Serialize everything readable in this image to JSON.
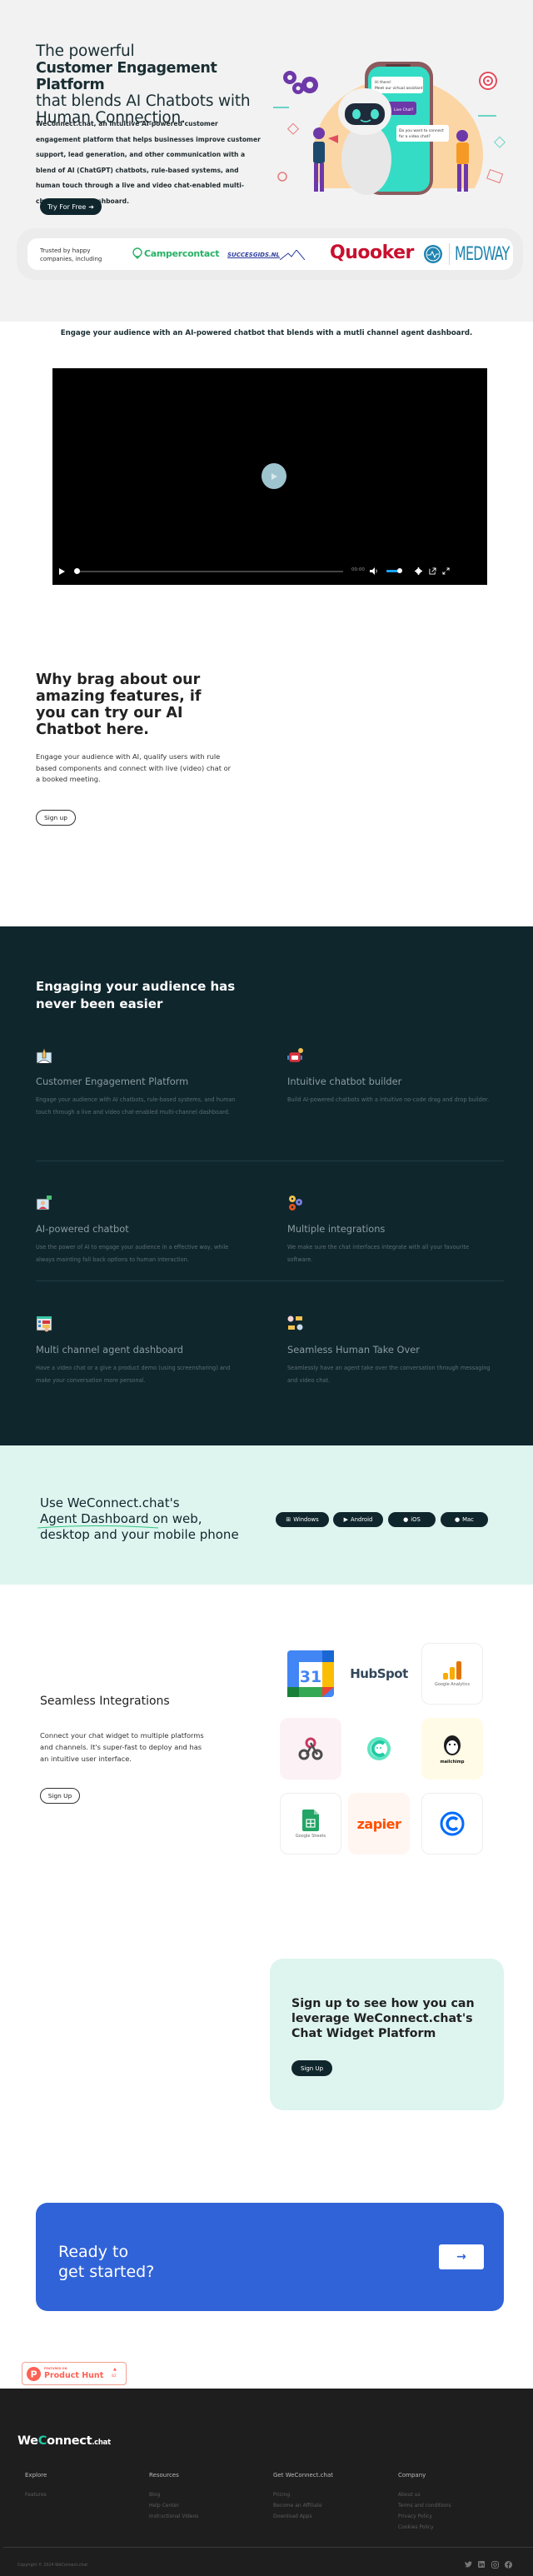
{
  "hero": {
    "title_line1": "The powerful",
    "title_bold": "Customer Engagement Platform",
    "title_line3": "that blends AI Chatbots with Human Connection.",
    "description": "WeConnect.chat, an intuitive AI-powered customer engagement platform that helps businesses improve customer support, lead generation, and other communication with a blend of AI (ChatGPT) chatbots, rule-based systems, and human touch through a live and video chat-enabled multi-channel agent dashboard.",
    "cta_label": "Try For Free",
    "cta_icon": "arrow-right-icon",
    "illustration": {
      "bubble1_line1": "Hi there!",
      "bubble1_line2": "Meet our virtual assistant",
      "bubble2": "Live Chat?",
      "bubble3_line1": "Do you want to connect",
      "bubble3_line2": "for a video chat?"
    }
  },
  "trusted": {
    "label": "Trusted by happy companies, including",
    "logos": [
      "Campercontact",
      "SUCCESGIDS.NL",
      "Quooker",
      "MEDWAY"
    ]
  },
  "video_section": {
    "subtitle": "Engage your audience with an AI-powered chatbot that blends with a mutli channel agent dashboard.",
    "player": {
      "time": "00:00",
      "progress_percent": 0,
      "volume_percent": 100,
      "icons": [
        "play-icon",
        "volume-icon",
        "settings-icon",
        "external-link-icon",
        "fullscreen-icon"
      ]
    }
  },
  "try_section": {
    "title": "Why brag about our amazing features, if you can try our AI Chatbot here.",
    "description": "Engage your audience with AI, qualify users with rule based components and connect with live (video) chat or a booked meeting.",
    "button_label": "Sign up"
  },
  "features": {
    "title": "Engaging your audience has never been easier",
    "items": [
      {
        "icon": "rocket-launch-icon",
        "title": "Customer Engagement Platform",
        "text": "Engage your audience with AI chatbots, rule-based systems, and human touch through a live and video chat-enabled multi-channel dashboard."
      },
      {
        "icon": "robot-icon",
        "title": "Intuitive chatbot builder",
        "text": "Build AI-powered chatbots with a intuitive no-code drag and drop builder."
      },
      {
        "icon": "video-agent-icon",
        "title": "AI-powered chatbot",
        "text": "Use the power of AI to engage your audience in a effective way, while always mainting fall back options to human interaction."
      },
      {
        "icon": "gears-icon",
        "title": "Multiple integrations",
        "text": "We make sure the chat interfaces integrate with all your favourite software."
      },
      {
        "icon": "dashboard-icon",
        "title": "Multi channel agent dashboard",
        "text": "Have a video chat or a give a product demo (using screensharing) and make your conversation more personal."
      },
      {
        "icon": "takeover-icon",
        "title": "Seamless Human Take Over",
        "text": "Seamlessly have an agent take over the conversation through messaging and video chat."
      }
    ]
  },
  "apps": {
    "title_line1": "Use WeConnect.chat's",
    "title_highlight": "Agent Dashboard",
    "title_line2_rest": " on web,",
    "title_line3": "desktop and your mobile phone",
    "buttons": [
      {
        "label": "Windows",
        "icon": "windows-icon"
      },
      {
        "label": "Android",
        "icon": "play-store-icon"
      },
      {
        "label": "iOS",
        "icon": "apple-icon"
      },
      {
        "label": "Mac",
        "icon": "apple-icon"
      }
    ]
  },
  "integrations": {
    "title": "Seamless Integrations",
    "description": "Connect your chat widget to multiple platforms and channels. It's super-fast to deploy and has an intuitive user interface.",
    "button_label": "Sign Up",
    "tiles": [
      {
        "name": "Google Calendar",
        "text": "31"
      },
      {
        "name": "HubSpot",
        "text": "HubSpot"
      },
      {
        "name": "Google Analytics",
        "text": "Google Analytics"
      },
      {
        "name": "Webhooks",
        "text": ""
      },
      {
        "name": "WeConnect",
        "text": ""
      },
      {
        "name": "Mailchimp",
        "text": "mailchimp"
      },
      {
        "name": "Google Sheets",
        "text": "Google Sheets"
      },
      {
        "name": "Zapier",
        "text": "zapier"
      },
      {
        "name": "Calendly",
        "text": ""
      }
    ]
  },
  "signup_card": {
    "title": "Sign up to see how you can leverage WeConnect.chat's Chat Widget Platform",
    "button_label": "Sign Up"
  },
  "ready": {
    "title_line1": "Ready to",
    "title_line2": "get started?",
    "button_icon": "arrow-right-icon"
  },
  "product_hunt": {
    "small": "FEATURED ON",
    "label": "Product Hunt",
    "votes": "82"
  },
  "footer": {
    "logo_we": "We",
    "logo_c": "C",
    "logo_onnect": "onnect",
    "logo_chat": ".chat",
    "columns": [
      {
        "title": "Explore",
        "links": [
          "Features"
        ]
      },
      {
        "title": "Resources",
        "links": [
          "Blog",
          "Help Center",
          "Instructional Videos"
        ]
      },
      {
        "title": "Get WeConnect.chat",
        "links": [
          "Pricing",
          "Become an Affiliate",
          "Download Apps"
        ]
      },
      {
        "title": "Company",
        "links": [
          "About us",
          "Terms and conditions",
          "Privacy Policy",
          "Cookies Policy"
        ]
      }
    ],
    "copyright": "Copyright © 2024 WeConnect.chat",
    "socials": [
      "twitter-icon",
      "linkedin-icon",
      "instagram-icon",
      "facebook-icon"
    ]
  }
}
